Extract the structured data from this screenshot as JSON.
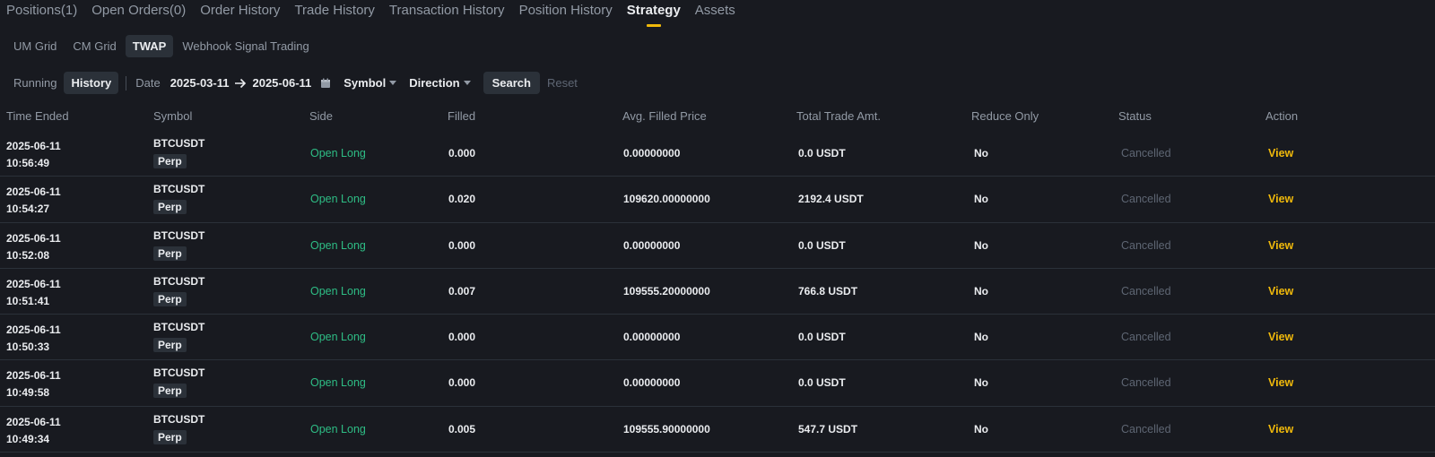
{
  "top_tabs": [
    {
      "label": "Positions(1)"
    },
    {
      "label": "Open Orders(0)"
    },
    {
      "label": "Order History"
    },
    {
      "label": "Trade History"
    },
    {
      "label": "Transaction History"
    },
    {
      "label": "Position History"
    },
    {
      "label": "Strategy",
      "active": true
    },
    {
      "label": "Assets"
    }
  ],
  "sub_tabs": [
    {
      "label": "UM Grid"
    },
    {
      "label": "CM Grid"
    },
    {
      "label": "TWAP",
      "active": true
    },
    {
      "label": "Webhook Signal Trading"
    }
  ],
  "filters": {
    "running_label": "Running",
    "history_label": "History",
    "date_label": "Date",
    "date_from": "2025-03-11",
    "date_to": "2025-06-11",
    "symbol_label": "Symbol",
    "direction_label": "Direction",
    "search_label": "Search",
    "reset_label": "Reset"
  },
  "table": {
    "headers": [
      "Time Ended",
      "Symbol",
      "Side",
      "Filled",
      "Avg. Filled Price",
      "Total Trade Amt.",
      "Reduce Only",
      "Status",
      "Action"
    ],
    "rows": [
      {
        "date": "2025-06-11",
        "time": "10:56:49",
        "symbol": "BTCUSDT",
        "badge": "Perp",
        "side": "Open Long",
        "filled": "0.000",
        "avg_price": "0.00000000",
        "total": "0.0 USDT",
        "reduce_only": "No",
        "status": "Cancelled",
        "action": "View"
      },
      {
        "date": "2025-06-11",
        "time": "10:54:27",
        "symbol": "BTCUSDT",
        "badge": "Perp",
        "side": "Open Long",
        "filled": "0.020",
        "avg_price": "109620.00000000",
        "total": "2192.4 USDT",
        "reduce_only": "No",
        "status": "Cancelled",
        "action": "View"
      },
      {
        "date": "2025-06-11",
        "time": "10:52:08",
        "symbol": "BTCUSDT",
        "badge": "Perp",
        "side": "Open Long",
        "filled": "0.000",
        "avg_price": "0.00000000",
        "total": "0.0 USDT",
        "reduce_only": "No",
        "status": "Cancelled",
        "action": "View"
      },
      {
        "date": "2025-06-11",
        "time": "10:51:41",
        "symbol": "BTCUSDT",
        "badge": "Perp",
        "side": "Open Long",
        "filled": "0.007",
        "avg_price": "109555.20000000",
        "total": "766.8 USDT",
        "reduce_only": "No",
        "status": "Cancelled",
        "action": "View"
      },
      {
        "date": "2025-06-11",
        "time": "10:50:33",
        "symbol": "BTCUSDT",
        "badge": "Perp",
        "side": "Open Long",
        "filled": "0.000",
        "avg_price": "0.00000000",
        "total": "0.0 USDT",
        "reduce_only": "No",
        "status": "Cancelled",
        "action": "View"
      },
      {
        "date": "2025-06-11",
        "time": "10:49:58",
        "symbol": "BTCUSDT",
        "badge": "Perp",
        "side": "Open Long",
        "filled": "0.000",
        "avg_price": "0.00000000",
        "total": "0.0 USDT",
        "reduce_only": "No",
        "status": "Cancelled",
        "action": "View"
      },
      {
        "date": "2025-06-11",
        "time": "10:49:34",
        "symbol": "BTCUSDT",
        "badge": "Perp",
        "side": "Open Long",
        "filled": "0.005",
        "avg_price": "109555.90000000",
        "total": "547.7 USDT",
        "reduce_only": "No",
        "status": "Cancelled",
        "action": "View"
      }
    ]
  },
  "colors": {
    "background": "#181a20",
    "accent": "#f0b90b",
    "buy_green": "#2ebd85",
    "muted": "#5e6673"
  },
  "icons": {
    "arrow": "arrow-right-icon",
    "calendar": "calendar-icon",
    "caret": "caret-down-icon"
  }
}
